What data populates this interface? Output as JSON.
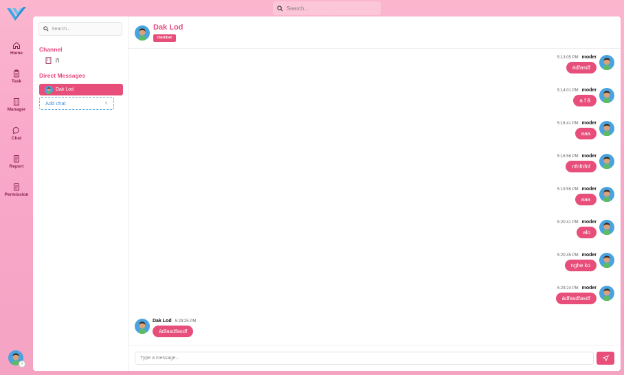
{
  "top_search": {
    "placeholder": "Search..."
  },
  "nav": [
    {
      "label": "Home",
      "icon": "home-icon"
    },
    {
      "label": "Task",
      "icon": "clipboard-icon"
    },
    {
      "label": "Manager",
      "icon": "building-icon"
    },
    {
      "label": "Chat",
      "icon": "chat-icon"
    },
    {
      "label": "Report",
      "icon": "report-icon"
    },
    {
      "label": "Permission",
      "icon": "permission-icon"
    }
  ],
  "sidebar": {
    "search_placeholder": "Search...",
    "channel_title": "Channel",
    "channel_item": "l'l",
    "dm_title": "Direct Messages",
    "dm_item": "Dak Lod",
    "add_chat": "Add chat"
  },
  "chat": {
    "header_name": "Dak Lod",
    "header_badge": "member",
    "messages": [
      {
        "time": "5:13:05 PM",
        "user": "moder",
        "text": "ádfasdf"
      },
      {
        "time": "5:14:01 PM",
        "user": "moder",
        "text": "a f â"
      },
      {
        "time": "5:16:41 PM",
        "user": "moder",
        "text": "aaa"
      },
      {
        "time": "5:16:56 PM",
        "user": "moder",
        "text": "nfnfnfnf"
      },
      {
        "time": "5:19:55 PM",
        "user": "moder",
        "text": "aaa"
      },
      {
        "time": "5:20:41 PM",
        "user": "moder",
        "text": "alo"
      },
      {
        "time": "5:20:45 PM",
        "user": "moder",
        "text": "nghe ko"
      },
      {
        "time": "5:29:24 PM",
        "user": "moder",
        "text": "ádfasdfasdf"
      }
    ],
    "incoming": {
      "time": "5:29:25 PM",
      "user": "Dak Lod",
      "text": "ádfasdfasdf"
    },
    "composer_placeholder": "Type a message..."
  },
  "colors": {
    "accent": "#e74e7a",
    "brand_pink": "#f9a8c9",
    "link_blue": "#3b8fd9"
  }
}
